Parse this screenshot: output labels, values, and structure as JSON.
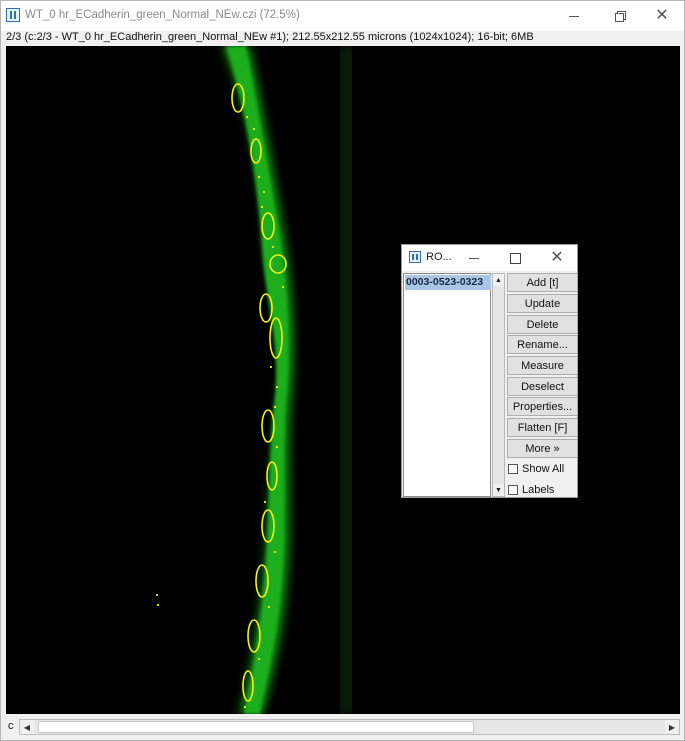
{
  "window": {
    "title": "WT_0 hr_ECadherin_green_Normal_NEw.czi (72.5%)",
    "info": "2/3 (c:2/3 - WT_0 hr_ECadherin_green_Normal_NEw #1); 212.55x212.55 microns (1024x1024); 16-bit; 6MB",
    "minimize_icon": "minimize-icon",
    "restore_icon": "restore-icon",
    "close_icon": "close-icon"
  },
  "statusbar": {
    "channel_label": "c",
    "scroll_left_icon": "arrow-left-icon",
    "scroll_right_icon": "arrow-right-icon"
  },
  "roi_manager": {
    "title": "RO...",
    "items": [
      "0003-0523-0323"
    ],
    "buttons": [
      "Add [t]",
      "Update",
      "Delete",
      "Rename...",
      "Measure",
      "Deselect",
      "Properties...",
      "Flatten [F]",
      "More »"
    ],
    "checkboxes": [
      {
        "label": "Show All",
        "checked": false
      },
      {
        "label": "Labels",
        "checked": false
      }
    ]
  },
  "colors": {
    "cell_green": "#1fae1f",
    "roi_yellow": "#f2f214",
    "background": "#000000",
    "selection": "#a9c6e4"
  }
}
